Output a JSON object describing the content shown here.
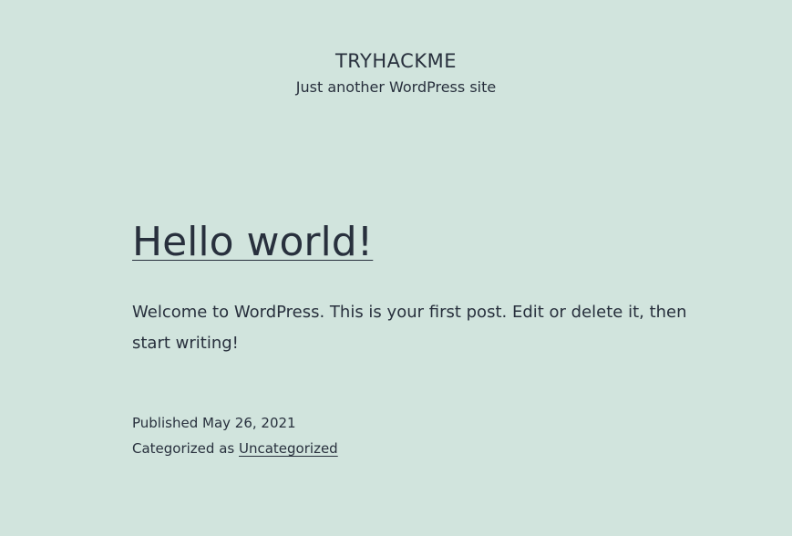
{
  "header": {
    "site_title": "TRYHACKME",
    "site_description": "Just another WordPress site"
  },
  "post": {
    "title": "Hello world!",
    "content": "Welcome to WordPress. This is your first post. Edit or delete it, then start writing!",
    "published_label": "Published",
    "published_date": "May 26, 2021",
    "category_label": "Categorized as",
    "category": "Uncategorized"
  },
  "colors": {
    "background": "#d1e4dd",
    "text": "#28303d"
  }
}
